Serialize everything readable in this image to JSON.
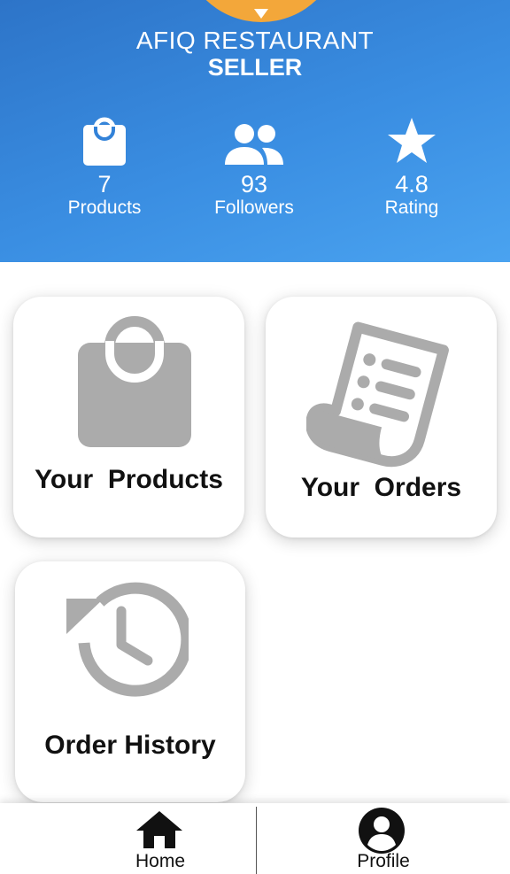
{
  "profile": {
    "store_name": "AFIQ RESTAURANT",
    "role": "SELLER"
  },
  "stats": [
    {
      "icon": "shopping-bag-icon",
      "value": "7",
      "label": "Products"
    },
    {
      "icon": "people-icon",
      "value": "93",
      "label": "Followers"
    },
    {
      "icon": "star-icon",
      "value": "4.8",
      "label": "Rating"
    }
  ],
  "menu": {
    "products": {
      "icon": "shopping-bag-icon",
      "label": "Your  Products"
    },
    "orders": {
      "icon": "receipt-icon",
      "label": "Your  Orders"
    },
    "history": {
      "icon": "history-icon",
      "label": "Order History"
    }
  },
  "bottom_nav": [
    {
      "icon": "home-icon",
      "label": "Home"
    },
    {
      "icon": "account-icon",
      "label": "Profile"
    }
  ],
  "colors": {
    "header_gradient_start": "#2d74c8",
    "header_gradient_end": "#4aa3f0",
    "avatar": "#f3a73a",
    "card_icon": "#ababab"
  }
}
